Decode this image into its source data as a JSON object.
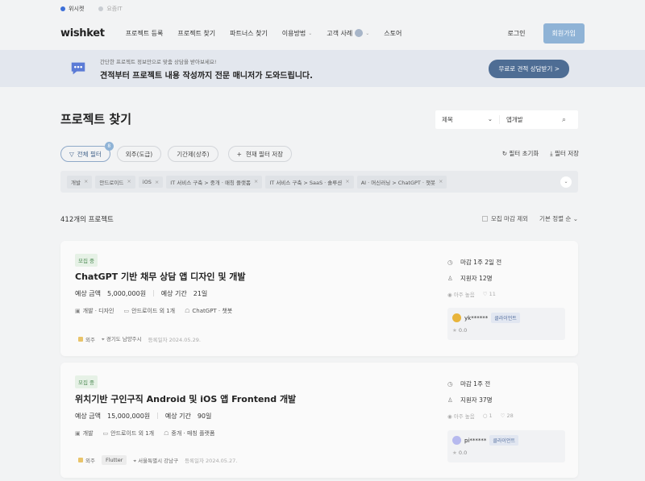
{
  "topstrip": {
    "site1": "위시켓",
    "site2": "요즘IT"
  },
  "header": {
    "logo": "wishket",
    "nav": [
      "프로젝트 등록",
      "프로젝트 찾기",
      "파트너스 찾기",
      "이용방법",
      "고객 사례",
      "스토어"
    ],
    "login": "로그인",
    "signup": "회원가입"
  },
  "banner": {
    "sub": "간단한 프로젝트 정보만으로 맞춤 상담을 받아보세요!",
    "main": "견적부터 프로젝트 내용 작성까지 전문 매니저가 도와드립니다.",
    "cta": "무료로 견적 상담받기 >"
  },
  "find": {
    "title": "프로젝트 찾기",
    "search_field": "제목",
    "search_query": "앱개발"
  },
  "filters": {
    "all": "전체 필터",
    "all_badge": "8",
    "outsource": "외주(도급)",
    "term": "기간제(상주)",
    "save_current": "현재 필터 저장",
    "reset": "필터 초기화",
    "save": "필터 저장"
  },
  "chips": [
    "개발",
    "안드로이드",
    "iOS",
    "IT 서비스 구축 > 중개 · 매칭 플랫폼",
    "IT 서비스 구축 > SaaS · 솔루션",
    "AI · 머신러닝 > ChatGPT · 챗봇"
  ],
  "list": {
    "count": "412개의 프로젝트",
    "closing_filter": "모집 마감 제외",
    "sort": "기본 정렬 순"
  },
  "projects": [
    {
      "status": "모집 중",
      "title": "ChatGPT 기반 채무 상담 앱 디자인 및 개발",
      "amount_label": "예상 금액",
      "amount": "5,000,000원",
      "period_label": "예상 기간",
      "period": "21일",
      "cats": [
        "개발 · 디자인",
        "안드로이드 외 1개",
        "ChatGPT · 챗봇"
      ],
      "type": "외주",
      "skill": "",
      "location": "경기도 남양주시",
      "date": "등록일자 2024.05.29.",
      "deadline": "마감 1주 2일 전",
      "applicants": "지원자 12명",
      "interest": "아주 높음",
      "likes": "11",
      "comments": "",
      "client": "yk******",
      "client_tag": "클라이언트",
      "rating": "0.0"
    },
    {
      "status": "모집 중",
      "title": "위치기반 구인구직 Android 및 iOS 앱 Frontend 개발",
      "amount_label": "예상 금액",
      "amount": "15,000,000원",
      "period_label": "예상 기간",
      "period": "90일",
      "cats": [
        "개발",
        "안드로이드 외 1개",
        "중개 · 매칭 플랫폼"
      ],
      "type": "외주",
      "skill": "Flutter",
      "location": "서울특별시 강남구",
      "date": "등록일자 2024.05.27.",
      "deadline": "마감 1주 전",
      "applicants": "지원자 37명",
      "interest": "아주 높음",
      "likes": "28",
      "comments": "1",
      "client": "pi******",
      "client_tag": "클라이언트",
      "rating": "0.0"
    }
  ]
}
